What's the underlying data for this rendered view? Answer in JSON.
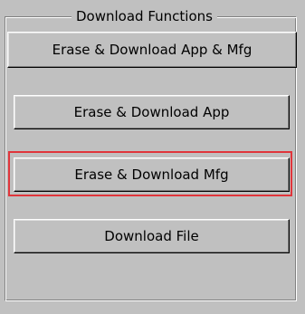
{
  "group": {
    "title": "Download Functions"
  },
  "buttons": [
    {
      "label": "Erase & Download App & Mfg"
    },
    {
      "label": "Erase & Download App"
    },
    {
      "label": "Erase & Download Mfg"
    },
    {
      "label": "Download File"
    }
  ],
  "colors": {
    "face": "#c0c0c0",
    "highlight_border": "#e0353b"
  }
}
